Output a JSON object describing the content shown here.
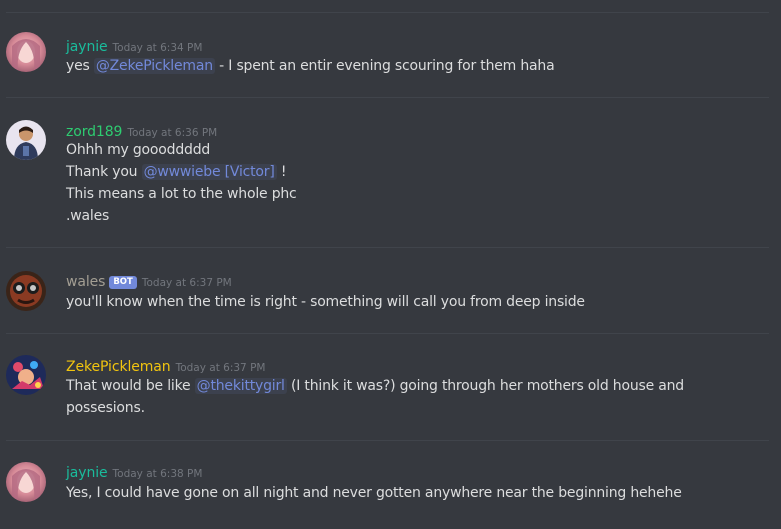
{
  "messages": [
    {
      "author": "jaynie",
      "author_color": "#1abc9c",
      "timestamp": "Today at 6:34 PM",
      "lines": [
        {
          "pre": "yes ",
          "mention": "@ZekePickleman",
          "post": "  - I spent an entir evening scouring for them haha"
        }
      ]
    },
    {
      "author": "zord189",
      "author_color": "#2ecc71",
      "timestamp": "Today at 6:36 PM",
      "lines": [
        {
          "text": "Ohhh my goooddddd"
        },
        {
          "pre": "Thank you ",
          "mention": "@wwwiebe [Victor]",
          "post": " !"
        },
        {
          "text": "This means a lot to the whole phc"
        },
        {
          "text": ".wales"
        }
      ]
    },
    {
      "author": "wales",
      "author_color": "#a39e93",
      "bot_tag": "BOT",
      "timestamp": "Today at 6:37 PM",
      "lines": [
        {
          "text": "you'll know when the time is right - something will call you from deep inside"
        }
      ]
    },
    {
      "author": "ZekePickleman",
      "author_color": "#f1c40f",
      "timestamp": "Today at 6:37 PM",
      "lines": [
        {
          "pre": "That would be like ",
          "mention": "@thekittygirl",
          "post": " (I think it was?) going through her mothers old house and"
        },
        {
          "text": "possesions."
        }
      ]
    },
    {
      "author": "jaynie",
      "author_color": "#1abc9c",
      "timestamp": "Today at 6:38 PM",
      "lines": [
        {
          "text": "Yes, I could have gone on all night and never gotten anywhere near the beginning hehehe"
        }
      ]
    }
  ]
}
